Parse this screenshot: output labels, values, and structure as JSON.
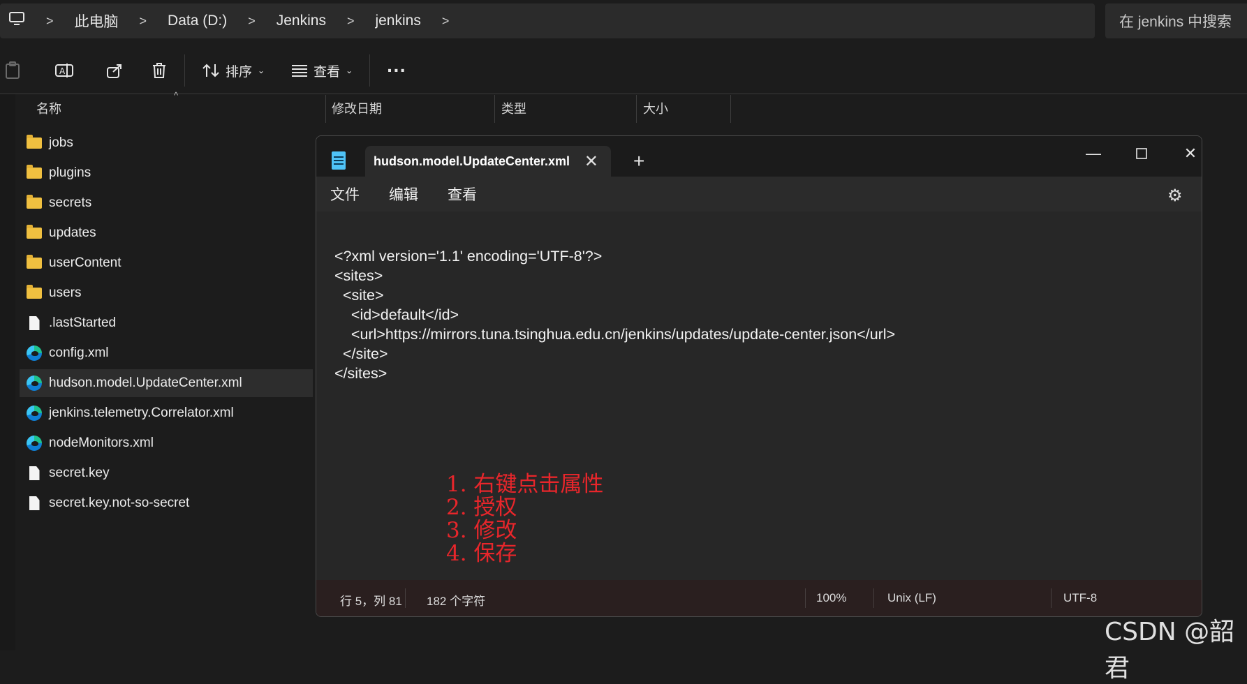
{
  "explorer": {
    "breadcrumbs": [
      "此电脑",
      "Data (D:)",
      "Jenkins",
      "jenkins"
    ],
    "search_placeholder": "在 jenkins 中搜索",
    "toolbar": {
      "sort_label": "排序",
      "view_label": "查看",
      "more_label": "···"
    },
    "columns": {
      "name": "名称",
      "modified": "修改日期",
      "type": "类型",
      "size": "大小"
    },
    "files": [
      {
        "name": "jobs",
        "icon": "folder-icon"
      },
      {
        "name": "plugins",
        "icon": "folder-icon"
      },
      {
        "name": "secrets",
        "icon": "folder-icon"
      },
      {
        "name": "updates",
        "icon": "folder-icon"
      },
      {
        "name": "userContent",
        "icon": "folder-icon"
      },
      {
        "name": "users",
        "icon": "folder-icon"
      },
      {
        "name": ".lastStarted",
        "icon": "file-icon"
      },
      {
        "name": "config.xml",
        "icon": "edge-icon"
      },
      {
        "name": "hudson.model.UpdateCenter.xml",
        "icon": "edge-icon",
        "selected": true
      },
      {
        "name": "jenkins.telemetry.Correlator.xml",
        "icon": "edge-icon"
      },
      {
        "name": "nodeMonitors.xml",
        "icon": "edge-icon"
      },
      {
        "name": "secret.key",
        "icon": "file-icon"
      },
      {
        "name": "secret.key.not-so-secret",
        "icon": "file-icon"
      }
    ]
  },
  "notepad": {
    "tab_title": "hudson.model.UpdateCenter.xml",
    "menu": [
      "文件",
      "编辑",
      "查看"
    ],
    "content_lines": [
      "<?xml version='1.1' encoding='UTF-8'?>",
      "<sites>",
      "  <site>",
      "    <id>default</id>",
      "    <url>https://mirrors.tuna.tsinghua.edu.cn/jenkins/updates/update-center.json</url>",
      "  </site>",
      "</sites>"
    ],
    "annotation_lines": [
      "1. 右键点击属性",
      "2. 授权",
      "3. 修改",
      "4. 保存"
    ],
    "status": {
      "position": "行 5，列 81",
      "chars": "182 个字符",
      "zoom": "100%",
      "line_ending": "Unix (LF)",
      "encoding": "UTF-8"
    }
  },
  "watermark": "CSDN @韶君",
  "colors": {
    "annotation": "#e8262b",
    "background": "#1c1c1c"
  }
}
